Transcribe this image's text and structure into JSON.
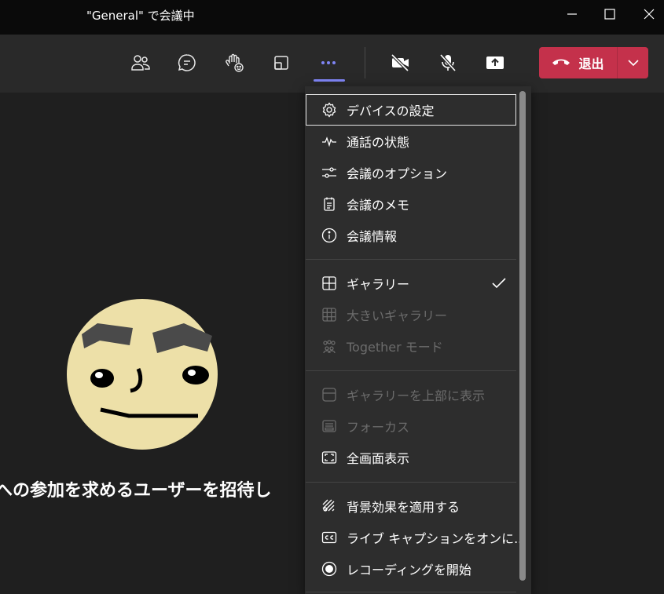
{
  "window": {
    "title": "\"General\" で会議中"
  },
  "toolbar": {
    "buttons": [
      {
        "name": "participants",
        "icon": "people-icon"
      },
      {
        "name": "chat",
        "icon": "chat-icon"
      },
      {
        "name": "raise-hand",
        "icon": "hand-emoji-icon"
      },
      {
        "name": "rooms",
        "icon": "rooms-icon"
      },
      {
        "name": "more-actions",
        "icon": "more-icon"
      },
      {
        "name": "camera-off",
        "icon": "camera-off-icon"
      },
      {
        "name": "mic-off",
        "icon": "mic-off-icon"
      },
      {
        "name": "share",
        "icon": "share-tray-icon"
      }
    ],
    "leave_label": "退出",
    "accent": "#7f85f5",
    "leave_color": "#c4314b"
  },
  "stage": {
    "invite_text": "への参加を求めるユーザーを招待し"
  },
  "menu": {
    "sections": [
      {
        "items": [
          {
            "label": "デバイスの設定",
            "icon": "gear-icon",
            "enabled": true,
            "focused": true
          },
          {
            "label": "通話の状態",
            "icon": "pulse-icon",
            "enabled": true
          },
          {
            "label": "会議のオプション",
            "icon": "sliders-icon",
            "enabled": true
          },
          {
            "label": "会議のメモ",
            "icon": "notes-icon",
            "enabled": true
          },
          {
            "label": "会議情報",
            "icon": "info-icon",
            "enabled": true
          }
        ]
      },
      {
        "items": [
          {
            "label": "ギャラリー",
            "icon": "gallery-icon",
            "enabled": true,
            "checked": true
          },
          {
            "label": "大きいギャラリー",
            "icon": "large-gallery-icon",
            "enabled": false
          },
          {
            "label": "Together モード",
            "icon": "together-mode-icon",
            "enabled": false
          }
        ]
      },
      {
        "items": [
          {
            "label": "ギャラリーを上部に表示",
            "icon": "gallery-top-icon",
            "enabled": false
          },
          {
            "label": "フォーカス",
            "icon": "focus-icon",
            "enabled": false
          },
          {
            "label": "全画面表示",
            "icon": "fullscreen-icon",
            "enabled": true
          }
        ]
      },
      {
        "items": [
          {
            "label": "背景効果を適用する",
            "icon": "background-effects-icon",
            "enabled": true
          },
          {
            "label": "ライブ キャプションをオンに...",
            "icon": "captions-icon",
            "enabled": true
          },
          {
            "label": "レコーディングを開始",
            "icon": "record-icon",
            "enabled": true
          }
        ]
      }
    ]
  }
}
